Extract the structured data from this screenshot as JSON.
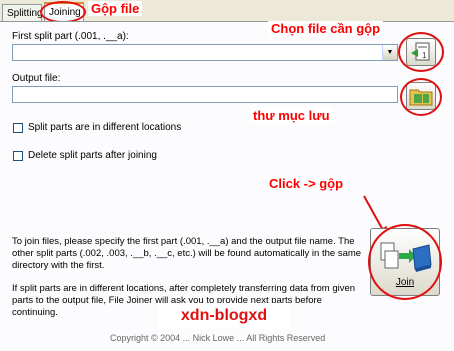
{
  "tabs": [
    {
      "label": "Splitting"
    },
    {
      "label": "Joining"
    }
  ],
  "annotations": {
    "tab_note": "Gộp file",
    "choose_file": "Chọn file cần gộp",
    "output_folder": "thư mục lưu",
    "click_join": "Click -> gộp",
    "watermark": "xdn-blogxd"
  },
  "form": {
    "first_part_label": "First split part (.001, .__a):",
    "first_part_value": "",
    "output_label": "Output file:",
    "output_value": "",
    "cb_different_locations": "Split parts are in different locations",
    "cb_delete_after": "Delete split parts after joining"
  },
  "info": {
    "paragraph1": "To join files, please specify the first part (.001, .__a) and the output file name. The other split parts (.002, .003, .__b, .__c, etc.) will be found automatically in the same directory with the first.",
    "paragraph2": "If split parts are in different locations, after completely transferring data from given parts to the output file, File Joiner will ask you to provide next parts before continuing."
  },
  "join_button": {
    "label": "Join"
  },
  "footer": {
    "partial_text": "Copyright © 2004 ... Nick Lowe ... All Rights Reserved"
  },
  "colors": {
    "annotation_red": "#ff0000",
    "accent_tab": "#e68b2c"
  }
}
